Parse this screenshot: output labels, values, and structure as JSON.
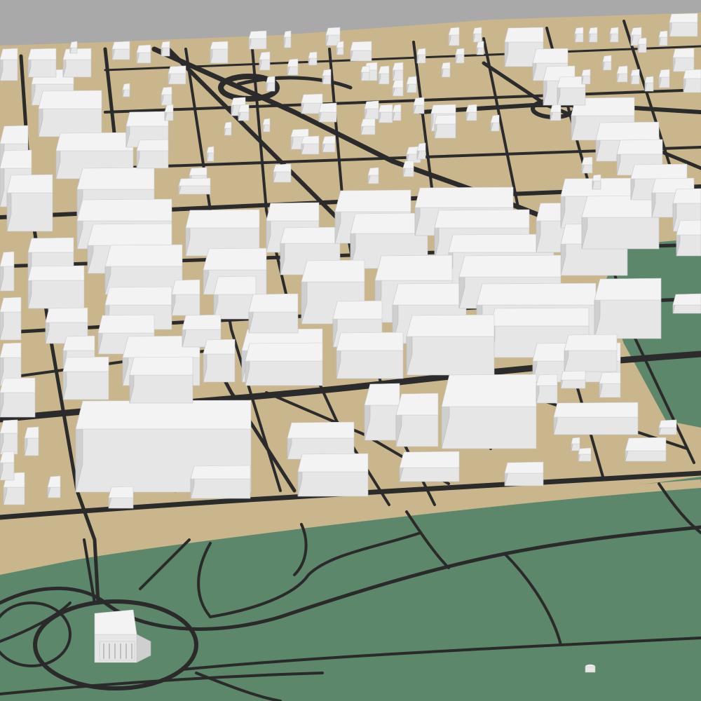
{
  "colors": {
    "sky": "#a9a9a9",
    "ground": "#c9b68c",
    "park": "#5d876a",
    "road": "#2b2b2b",
    "building": "#ececec",
    "building_shadow": "#cfcfcf"
  },
  "map": {
    "style": "3d-extruded-city-model",
    "labels": []
  }
}
